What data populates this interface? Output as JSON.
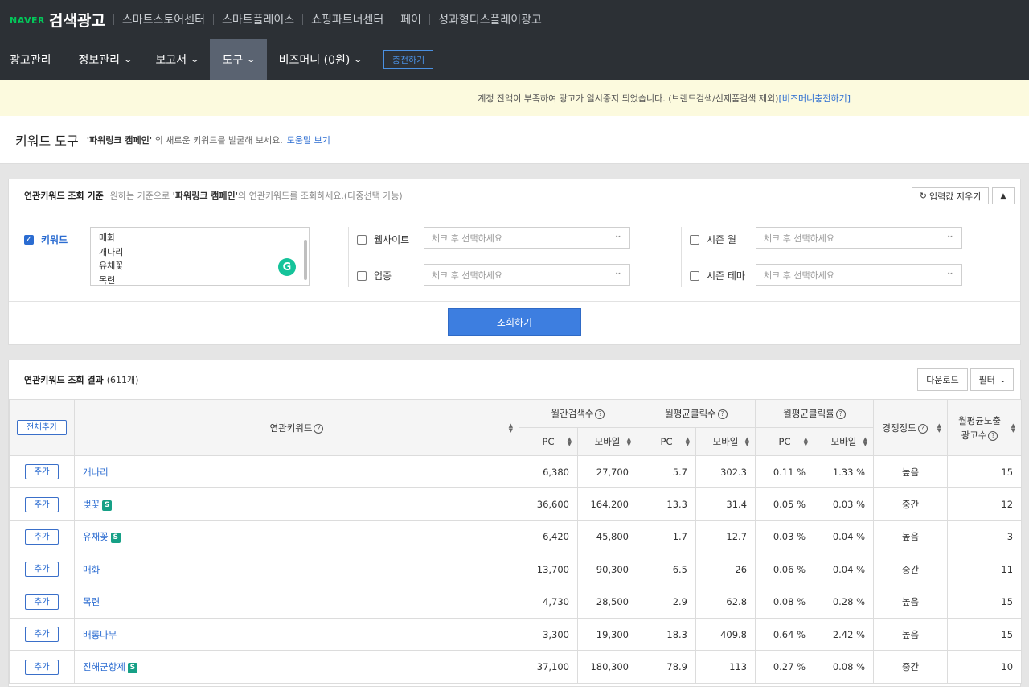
{
  "topbar": {
    "brand": "NAVER",
    "product": "검색광고",
    "services": [
      "스마트스토어센터",
      "스마트플레이스",
      "쇼핑파트너센터",
      "페이",
      "성과형디스플레이광고"
    ]
  },
  "nav": {
    "items": [
      {
        "label": "광고관리",
        "dropdown": false
      },
      {
        "label": "정보관리",
        "dropdown": true
      },
      {
        "label": "보고서",
        "dropdown": true
      },
      {
        "label": "도구",
        "dropdown": true,
        "active": true
      },
      {
        "label": "비즈머니 (0원)",
        "dropdown": true
      }
    ],
    "charge_label": "충전하기"
  },
  "notice": {
    "text": "계정 잔액이 부족하여 광고가 일시중지 되었습니다. (브랜드검색/신제품검색 제외)",
    "link": "[비즈머니충전하기]"
  },
  "page": {
    "title": "키워드 도구",
    "desc_campaign": "'파워링크 캠페인'",
    "desc_rest": "의 새로운 키워드를 발굴해 보세요.",
    "help_link": "도움말 보기"
  },
  "criteria": {
    "title": "연관키워드 조회 기준",
    "desc_pre": "원하는 기준으로",
    "desc_campaign": "'파워링크 캠페인'",
    "desc_post": "의 연관키워드를 조회하세요.(다중선택 가능)",
    "clear_label": "입력값 지우기",
    "keyword_label": "키워드",
    "keyword_checked": true,
    "keywords": [
      "매화",
      "개나리",
      "유채꽃",
      "목련"
    ],
    "website_label": "웹사이트",
    "industry_label": "업종",
    "season_month_label": "시즌 월",
    "season_theme_label": "시즌 테마",
    "select_placeholder": "체크 후 선택하세요",
    "search_label": "조회하기"
  },
  "results": {
    "title": "연관키워드 조회 결과",
    "count": "(611개)",
    "download_label": "다운로드",
    "filter_label": "필터",
    "headers": {
      "add_all": "전체추가",
      "keyword": "연관키워드",
      "monthly_search": "월간검색수",
      "avg_clicks": "월평균클릭수",
      "avg_ctr": "월평균클릭률",
      "competition": "경쟁정도",
      "avg_ads_line1": "월평균노출",
      "avg_ads_line2": "광고수",
      "pc": "PC",
      "mobile": "모바일"
    },
    "add_label": "추가",
    "rows": [
      {
        "keyword": "개나리",
        "s": false,
        "pc": "6,380",
        "mobile": "27,700",
        "clk_pc": "5.7",
        "clk_mobile": "302.3",
        "ctr_pc": "0.11 %",
        "ctr_mobile": "1.33 %",
        "comp": "높음",
        "ads": "15"
      },
      {
        "keyword": "벚꽃",
        "s": true,
        "pc": "36,600",
        "mobile": "164,200",
        "clk_pc": "13.3",
        "clk_mobile": "31.4",
        "ctr_pc": "0.05 %",
        "ctr_mobile": "0.03 %",
        "comp": "중간",
        "ads": "12"
      },
      {
        "keyword": "유채꽃",
        "s": true,
        "pc": "6,420",
        "mobile": "45,800",
        "clk_pc": "1.7",
        "clk_mobile": "12.7",
        "ctr_pc": "0.03 %",
        "ctr_mobile": "0.04 %",
        "comp": "높음",
        "ads": "3"
      },
      {
        "keyword": "매화",
        "s": false,
        "pc": "13,700",
        "mobile": "90,300",
        "clk_pc": "6.5",
        "clk_mobile": "26",
        "ctr_pc": "0.06 %",
        "ctr_mobile": "0.04 %",
        "comp": "중간",
        "ads": "11"
      },
      {
        "keyword": "목련",
        "s": false,
        "pc": "4,730",
        "mobile": "28,500",
        "clk_pc": "2.9",
        "clk_mobile": "62.8",
        "ctr_pc": "0.08 %",
        "ctr_mobile": "0.28 %",
        "comp": "높음",
        "ads": "15"
      },
      {
        "keyword": "배롱나무",
        "s": false,
        "pc": "3,300",
        "mobile": "19,300",
        "clk_pc": "18.3",
        "clk_mobile": "409.8",
        "ctr_pc": "0.64 %",
        "ctr_mobile": "2.42 %",
        "comp": "높음",
        "ads": "15"
      },
      {
        "keyword": "진해군항제",
        "s": true,
        "pc": "37,100",
        "mobile": "180,300",
        "clk_pc": "78.9",
        "clk_mobile": "113",
        "ctr_pc": "0.27 %",
        "ctr_mobile": "0.08 %",
        "comp": "중간",
        "ads": "10"
      }
    ]
  },
  "colors": {
    "brand_green": "#03c75a",
    "link_blue": "#2b6cd1",
    "primary_button": "#3d7ee0",
    "topbar_bg": "#2c3035",
    "notice_bg": "#fcfade"
  }
}
